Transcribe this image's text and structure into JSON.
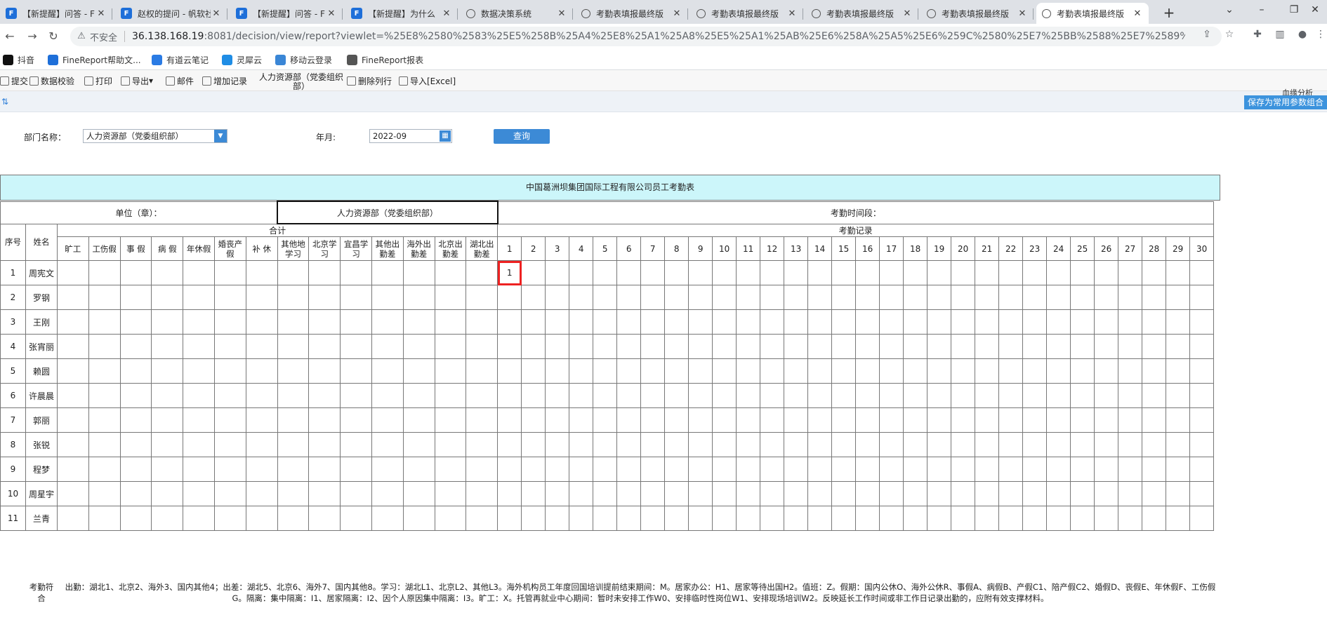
{
  "tabs": [
    {
      "label": "【新提醒】问答 - F",
      "icon": "finereport-logo-icon",
      "active": false
    },
    {
      "label": "赵权的提问 - 帆软社",
      "icon": "finereport-logo-icon",
      "active": false
    },
    {
      "label": "【新提醒】问答 - F",
      "icon": "finereport-logo-icon",
      "active": false
    },
    {
      "label": "【新提醒】为什么",
      "icon": "finereport-logo-icon",
      "active": false
    },
    {
      "label": "数据决策系统",
      "icon": "globe-icon",
      "active": false
    },
    {
      "label": "考勤表填报最终版",
      "icon": "globe-icon",
      "active": false
    },
    {
      "label": "考勤表填报最终版",
      "icon": "globe-icon",
      "active": false
    },
    {
      "label": "考勤表填报最终版",
      "icon": "globe-icon",
      "active": false
    },
    {
      "label": "考勤表填报最终版",
      "icon": "globe-icon",
      "active": false
    },
    {
      "label": "考勤表填报最终版",
      "icon": "globe-icon",
      "active": true
    }
  ],
  "address": {
    "insecure_label": "不安全",
    "host": "36.138.168.19",
    "rest": ":8081/decision/view/report?viewlet=%25E8%2580%2583%25E5%258B%25A4%25E8%25A1%25A8%25E5%25A1%25AB%25E6%258A%25A5%25E6%259C%2580%25E7%25BB%2588%25E7%2589%2588%25E6%..."
  },
  "bookmarks": [
    {
      "label": "抖音",
      "color": "#111111"
    },
    {
      "label": "FineReport帮助文...",
      "color": "#1e6fd9"
    },
    {
      "label": "有道云笔记",
      "color": "#2a7be4"
    },
    {
      "label": "灵犀云",
      "color": "#1f8de5"
    },
    {
      "label": "移动云登录",
      "color": "#3a86d6"
    },
    {
      "label": "FineReport报表",
      "color": "#555555"
    }
  ],
  "toolbar": {
    "items": [
      "提交",
      "数据校验",
      "打印",
      "导出",
      "邮件",
      "增加记录",
      "删除列行",
      "导入[Excel]"
    ],
    "dept_label": "人力资源部（党委组织部）",
    "save_params": "保存为常用参数组合",
    "analysis": "血缘分析"
  },
  "params": {
    "dept_label": "部门名称：",
    "dept_value": "人力资源部（党委组织部）",
    "month_label": "年月:",
    "month_value": "2022-09",
    "query_button": "查询"
  },
  "report": {
    "title": "中国葛洲坝集团国际工程有限公司员工考勤表",
    "unit_label": "单位（章）：",
    "unit_value": "人力资源部（党委组织部）",
    "period_label": "考勤时间段：",
    "total_label": "合计",
    "record_label": "考勤记录",
    "col_seq": "序号",
    "col_name": "姓名",
    "total_cols": [
      "旷工",
      "工伤假",
      "事 假",
      "病 假",
      "年休假",
      "婚丧产假",
      "补 休",
      "其他地学习",
      "北京学习",
      "宜昌学习",
      "其他出勤差",
      "海外出勤差",
      "北京出勤差",
      "湖北出勤差"
    ],
    "days": [
      "1",
      "2",
      "3",
      "4",
      "5",
      "6",
      "7",
      "8",
      "9",
      "10",
      "11",
      "12",
      "13",
      "14",
      "15",
      "16",
      "17",
      "18",
      "19",
      "20",
      "21",
      "22",
      "23",
      "24",
      "25",
      "26",
      "27",
      "28",
      "29",
      "30"
    ],
    "rows": [
      {
        "seq": "1",
        "name": "周宪文",
        "day1": "1"
      },
      {
        "seq": "2",
        "name": "罗钢",
        "day1": ""
      },
      {
        "seq": "3",
        "name": "王刚",
        "day1": ""
      },
      {
        "seq": "4",
        "name": "张宵丽",
        "day1": ""
      },
      {
        "seq": "5",
        "name": "赖圆",
        "day1": ""
      },
      {
        "seq": "6",
        "name": "许晨晨",
        "day1": ""
      },
      {
        "seq": "7",
        "name": "郭丽",
        "day1": ""
      },
      {
        "seq": "8",
        "name": "张锐",
        "day1": ""
      },
      {
        "seq": "9",
        "name": "程梦",
        "day1": ""
      },
      {
        "seq": "10",
        "name": "周星宇",
        "day1": ""
      },
      {
        "seq": "11",
        "name": "兰青",
        "day1": ""
      }
    ],
    "legend_label": "考勤符合",
    "legend_text": "出勤：湖北1、北京2、海外3、国内其他4；出差：湖北5、北京6、海外7、国内其他8。学习：湖北L1、北京L2、其他L3。海外机构员工年度回国培训提前结束期间：M。居家办公：H1、居家等待出国H2。值班：Z。假期：国内公休O、海外公休R、事假A、病假B、产假C1、陪产假C2、婚假D、丧假E、年休假F、工伤假G。隔离：集中隔离：I1、居家隔离：I2、因个人原因集中隔离：I3。旷工：X。托管再就业中心期间：暂时未安排工作W0、安排临时性岗位W1、安排现场培训W2。反映延长工作时间或非工作日记录出勤的，应附有效支撑材料。"
  }
}
